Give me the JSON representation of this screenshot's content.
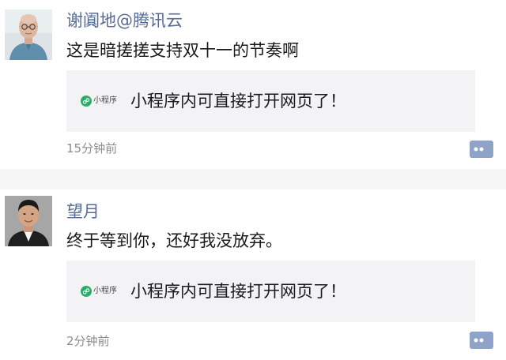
{
  "colors": {
    "name": "#576b95",
    "text": "#1a1a1a",
    "card_background": "#f3f3f5",
    "time": "#8c8c8c",
    "mini_program_green": "#2aae67",
    "comment_button": "#8fa3c8"
  },
  "posts": [
    {
      "author": "谢阗地@腾讯云",
      "text": "这是暗搓搓支持双十一的节奏啊",
      "card": {
        "badge_icon": "mini-program-icon",
        "badge_label": "小程序",
        "title": "小程序内可直接打开网页了！"
      },
      "time": "15分钟前",
      "comment_icon": "comment-icon"
    },
    {
      "author": "望月",
      "text": "终于等到你，还好我没放弃。",
      "card": {
        "badge_icon": "mini-program-icon",
        "badge_label": "小程序",
        "title": "小程序内可直接打开网页了！"
      },
      "time": "2分钟前",
      "comment_icon": "comment-icon"
    }
  ]
}
